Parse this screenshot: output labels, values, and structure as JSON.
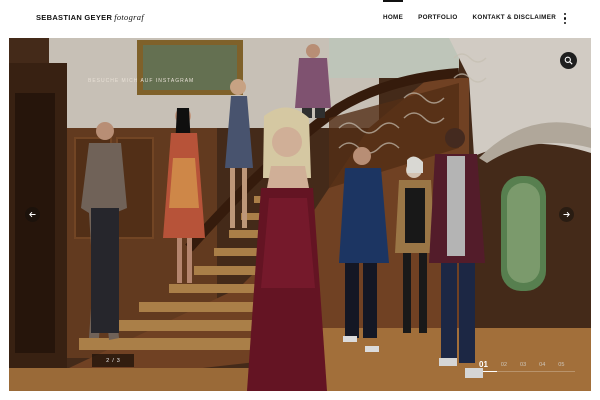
{
  "header": {
    "logo_name": "SEBASTIAN GEYER",
    "logo_role": "fotograf",
    "nav": [
      {
        "label": "HOME",
        "active": true
      },
      {
        "label": "PORTFOLIO",
        "active": false
      },
      {
        "label": "KONTAKT & DISCLAIMER",
        "active": false
      }
    ]
  },
  "hero": {
    "caption": "BESUCHE MICH AUF INSTAGRAM",
    "counter": {
      "current": "2",
      "separator": "/",
      "total": "3"
    },
    "slides": [
      "01",
      "02",
      "03",
      "04",
      "05"
    ],
    "active_slide": "01",
    "progress": 0.15
  },
  "icons": {
    "search": "search-icon",
    "menu": "kebab-menu-icon",
    "prev": "arrow-left-icon",
    "next": "arrow-right-icon"
  }
}
